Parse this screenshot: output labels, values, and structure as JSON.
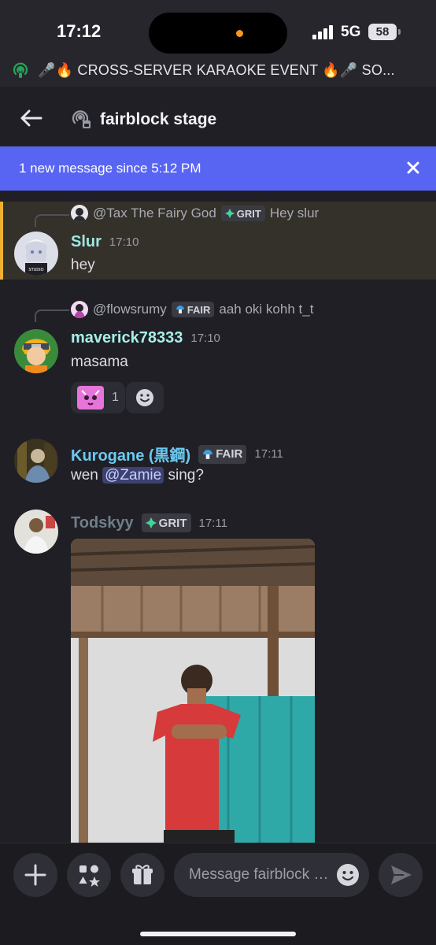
{
  "status_bar": {
    "time": "17:12",
    "network": "5G",
    "battery": "58"
  },
  "event_banner": {
    "text": "🎤🔥 CROSS-SERVER KARAOKE EVENT 🔥🎤 SO..."
  },
  "header": {
    "title": "fairblock stage"
  },
  "new_messages_bar": {
    "text": "1 new message since 5:12 PM"
  },
  "messages": [
    {
      "reply": {
        "user": "@Tax The Fairy God",
        "tag": "GRIT",
        "preview": "Hey slur"
      },
      "username": "Slur",
      "username_color": "#9fe7e1",
      "time": "17:10",
      "text": "hey",
      "highlighted": true
    },
    {
      "reply": {
        "user": "@flowsrumy",
        "tag": "FAIR",
        "preview": "aah oki kohh t_t"
      },
      "username": "maverick78333",
      "username_color": "#a6f0e9",
      "time": "17:10",
      "text": "masama",
      "reactions": [
        {
          "emoji": "pink-cat-emoji",
          "count": "1"
        }
      ]
    },
    {
      "username": "Kurogane (黒鋼)",
      "username_color": "#6cc9ef",
      "tag": "FAIR",
      "time": "17:11",
      "text_before": "wen ",
      "mention": "@Zamie",
      "text_after": " sing?"
    },
    {
      "username": "Todskyy",
      "username_color": "#6f7f8a",
      "tag": "GRIT",
      "time": "17:11",
      "attachment": "photo of a man in a red shirt in a room with a teal door"
    }
  ],
  "composer": {
    "placeholder": "Message fairblock stage"
  },
  "colors": {
    "accent": "#5865f2",
    "background": "#1f1f25",
    "highlight_border": "#f0b132"
  }
}
